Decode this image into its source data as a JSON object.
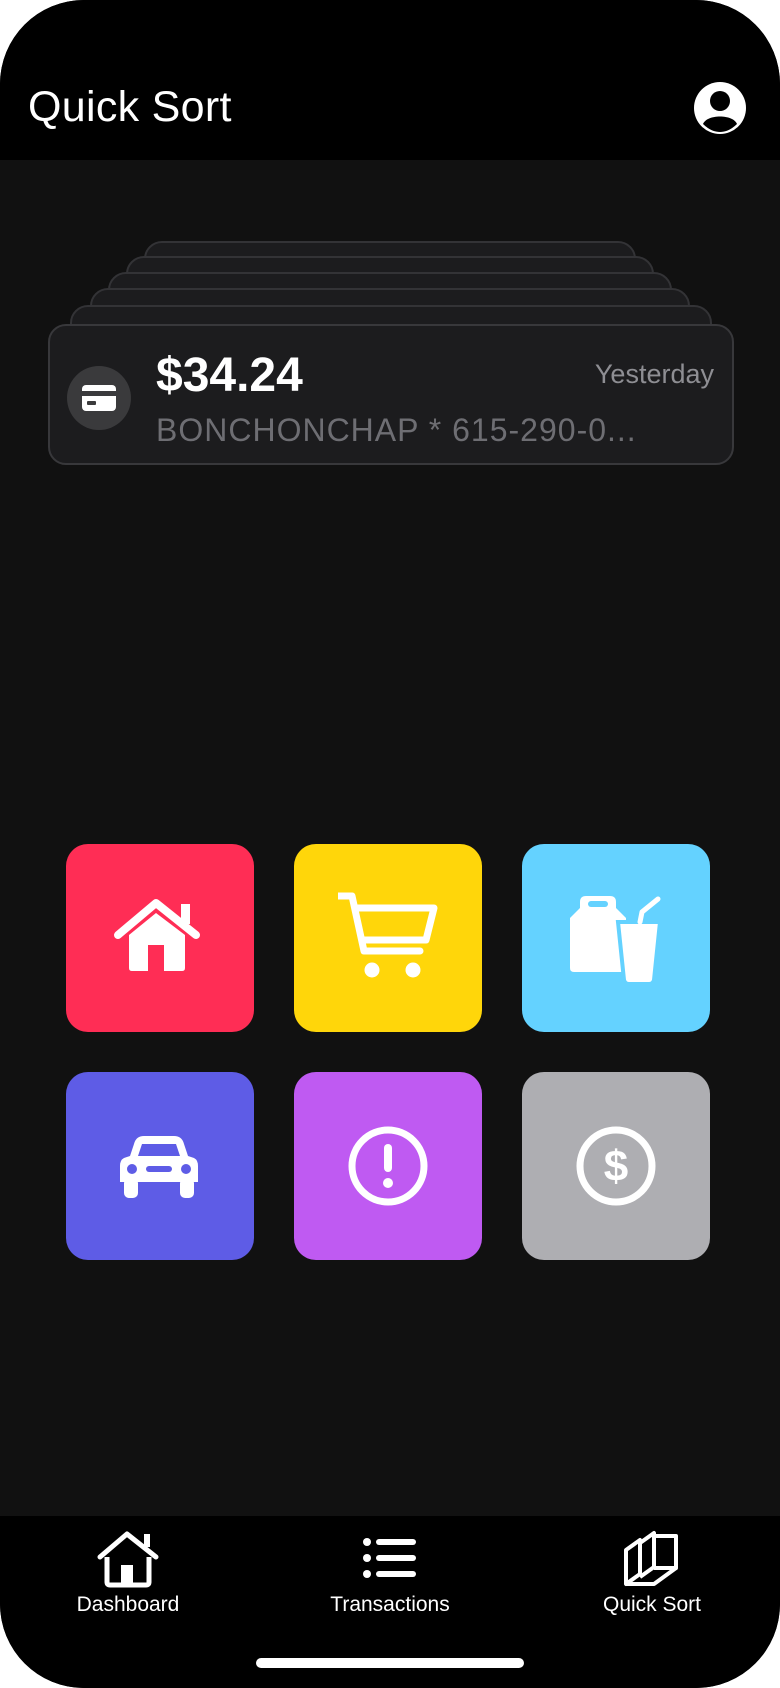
{
  "header": {
    "title": "Quick Sort",
    "profile_icon": "person-circle-icon"
  },
  "card": {
    "amount": "$34.24",
    "date": "Yesterday",
    "merchant": "BONCHONCHAP * 615-290-0...",
    "icon": "credit-card-icon"
  },
  "categories": [
    {
      "icon": "house-icon",
      "color": "#ff2d55"
    },
    {
      "icon": "cart-icon",
      "color": "#ffd60a"
    },
    {
      "icon": "takeout-drink-icon",
      "color": "#64d2ff"
    },
    {
      "icon": "car-icon",
      "color": "#5e5ce6"
    },
    {
      "icon": "exclamation-circle-icon",
      "color": "#bf5af2"
    },
    {
      "icon": "dollar-circle-icon",
      "color": "#aeaeb2"
    }
  ],
  "tabbar": {
    "items": [
      {
        "label": "Dashboard",
        "icon": "house-icon"
      },
      {
        "label": "Transactions",
        "icon": "list-icon"
      },
      {
        "label": "Quick Sort",
        "icon": "stacked-cards-icon"
      }
    ]
  }
}
